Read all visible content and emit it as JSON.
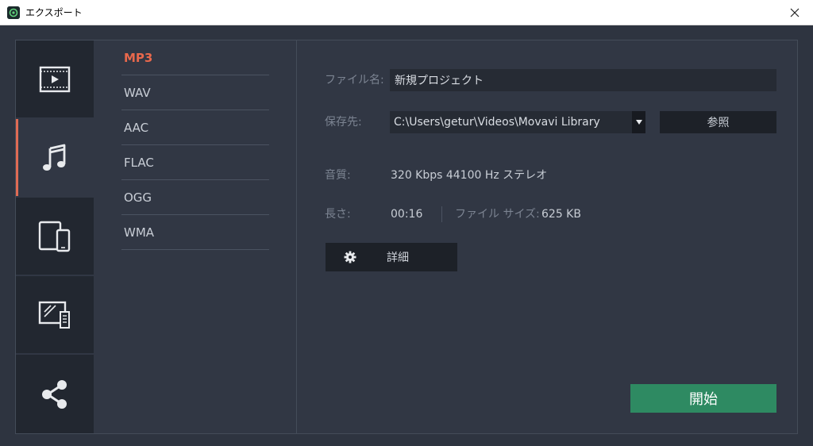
{
  "window": {
    "title": "エクスポート"
  },
  "sidebar": {
    "items": [
      {
        "name": "video",
        "icon": "film-icon"
      },
      {
        "name": "audio",
        "icon": "music-note-icon",
        "active": true
      },
      {
        "name": "devices",
        "icon": "devices-icon"
      },
      {
        "name": "tv",
        "icon": "tv-icon"
      },
      {
        "name": "share",
        "icon": "share-icon"
      }
    ]
  },
  "formats": {
    "items": [
      "MP3",
      "WAV",
      "AAC",
      "FLAC",
      "OGG",
      "WMA"
    ],
    "selected": "MP3"
  },
  "details": {
    "file_name_label": "ファイル名:",
    "file_name_value": "新規プロジェクト",
    "save_to_label": "保存先:",
    "save_to_value": "C:\\Users\\getur\\Videos\\Movavi Library",
    "browse_label": "参照",
    "quality_label": "音質:",
    "quality_value": "320 Kbps 44100 Hz ステレオ",
    "length_label": "長さ:",
    "length_value": "00:16",
    "file_size_label": "ファイル サイズ:",
    "file_size_value": "625 KB",
    "advanced_label": "詳細",
    "start_label": "開始"
  },
  "colors": {
    "accent": "#e8684c",
    "start": "#2e8a62",
    "background": "#2e3440",
    "sidebar": "#222730"
  }
}
